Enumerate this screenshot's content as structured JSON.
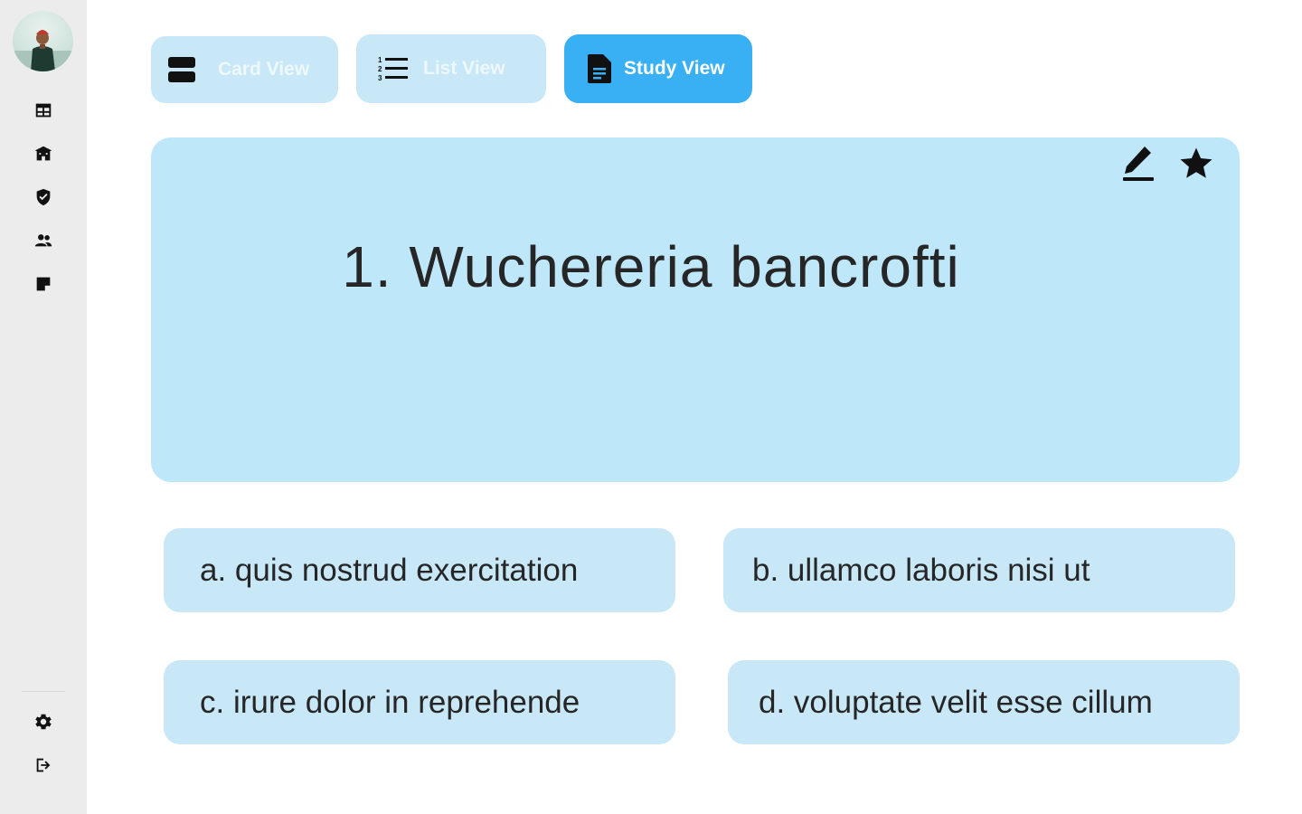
{
  "sidebar": {
    "items": [
      {
        "icon": "table-icon"
      },
      {
        "icon": "school-icon"
      },
      {
        "icon": "verified-shield-icon"
      },
      {
        "icon": "people-icon"
      },
      {
        "icon": "sticky-note-icon"
      }
    ],
    "bottom_items": [
      {
        "icon": "settings-icon"
      },
      {
        "icon": "logout-icon"
      }
    ]
  },
  "view_toggle": {
    "card_view_label": "Card View",
    "list_view_label": "List View",
    "study_view_label": "Study View",
    "active": "Study View"
  },
  "question": {
    "text": "1. Wuchereria bancrofti"
  },
  "options": [
    {
      "text": "a. quis nostrud exercitation"
    },
    {
      "text": "b. ullamco laboris nisi ut"
    },
    {
      "text": "c. irure dolor in reprehende"
    },
    {
      "text": "d. voluptate velit esse cillum"
    }
  ],
  "colors": {
    "sidebar_bg": "#ececec",
    "card_bg": "#bee7fa",
    "option_bg": "#c8e8f8",
    "active_accent": "#3ab0f4"
  }
}
